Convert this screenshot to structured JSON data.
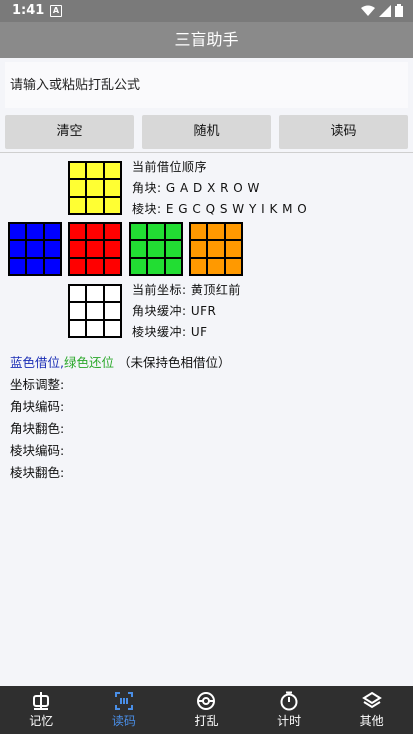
{
  "status": {
    "time": "1:41",
    "app_badge": "A"
  },
  "title": "三盲助手",
  "input": {
    "placeholder": "请输入或粘贴打乱公式",
    "value": ""
  },
  "buttons": {
    "clear": "清空",
    "random": "随机",
    "read": "读码"
  },
  "info": {
    "order_title": "当前借位顺序",
    "corner_label": "角块:",
    "corner_value": "G A D X R O W",
    "edge_label": "棱块:",
    "edge_value": "E G C Q S W Y I K M O",
    "coord_label": "当前坐标:",
    "coord_value": "黄顶红前",
    "corner_buffer_label": "角块缓冲:",
    "corner_buffer_value": "UFR",
    "edge_buffer_label": "棱块缓冲:",
    "edge_buffer_value": "UF"
  },
  "legend": {
    "blue_text": "蓝色借位,",
    "green_text": "绿色还位",
    "note": "（未保持色相借位）"
  },
  "params": {
    "coord_adjust": "坐标调整:",
    "corner_code": "角块编码:",
    "corner_flip": "角块翻色:",
    "edge_code": "棱块编码:",
    "edge_flip": "棱块翻色:"
  },
  "colors": {
    "top": "#ffff33",
    "left": "#0000ff",
    "front": "#ff0000",
    "right": "#22dd33",
    "back": "#ff9900",
    "bottom": "#ffffff"
  },
  "nav": [
    {
      "label": "记忆",
      "icon": "memory-icon"
    },
    {
      "label": "读码",
      "icon": "scan-code-icon"
    },
    {
      "label": "打乱",
      "icon": "scramble-icon"
    },
    {
      "label": "计时",
      "icon": "timer-icon"
    },
    {
      "label": "其他",
      "icon": "layers-icon"
    }
  ]
}
